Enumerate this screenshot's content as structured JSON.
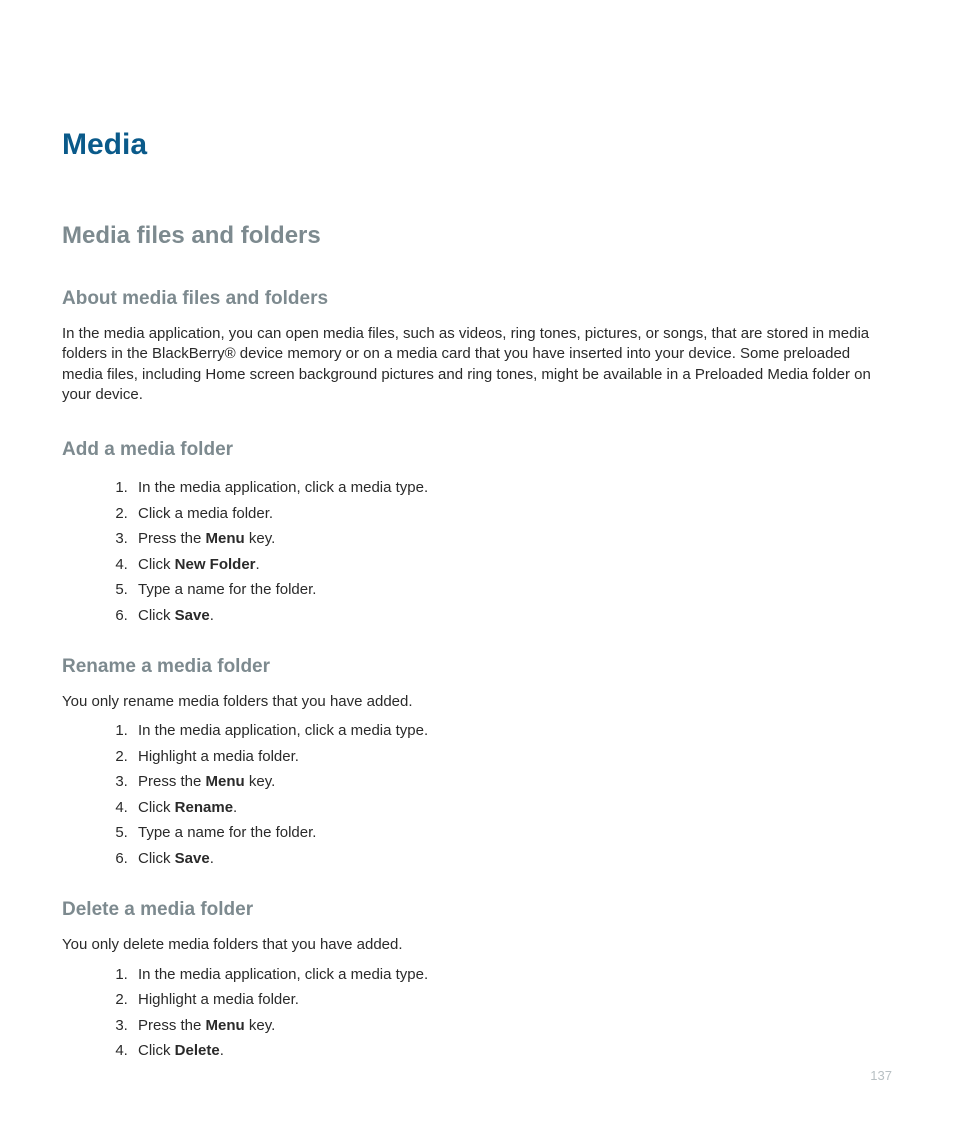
{
  "title": "Media",
  "section": "Media files and folders",
  "about": {
    "heading": "About media files and folders",
    "text": "In the media application, you can open media files, such as videos, ring tones, pictures, or songs, that are stored in media folders in the BlackBerry® device memory or on a media card that you have inserted into your device. Some preloaded media files, including Home screen background pictures and ring tones, might be available in a Preloaded Media folder on your device."
  },
  "add": {
    "heading": "Add a media folder",
    "steps": [
      {
        "pre": "In the media application, click a media type.",
        "bold": "",
        "post": ""
      },
      {
        "pre": "Click a media folder.",
        "bold": "",
        "post": ""
      },
      {
        "pre": "Press the ",
        "bold": "Menu",
        "post": " key."
      },
      {
        "pre": "Click ",
        "bold": "New Folder",
        "post": "."
      },
      {
        "pre": "Type a name for the folder.",
        "bold": "",
        "post": ""
      },
      {
        "pre": "Click ",
        "bold": "Save",
        "post": "."
      }
    ]
  },
  "rename": {
    "heading": "Rename a media folder",
    "note": "You only rename media folders that you have added.",
    "steps": [
      {
        "pre": "In the media application, click a media type.",
        "bold": "",
        "post": ""
      },
      {
        "pre": "Highlight a media folder.",
        "bold": "",
        "post": ""
      },
      {
        "pre": "Press the ",
        "bold": "Menu",
        "post": " key."
      },
      {
        "pre": "Click ",
        "bold": "Rename",
        "post": "."
      },
      {
        "pre": "Type a name for the folder.",
        "bold": "",
        "post": ""
      },
      {
        "pre": "Click ",
        "bold": "Save",
        "post": "."
      }
    ]
  },
  "del": {
    "heading": "Delete a media folder",
    "note": "You only delete media folders that you have added.",
    "steps": [
      {
        "pre": "In the media application, click a media type.",
        "bold": "",
        "post": ""
      },
      {
        "pre": "Highlight a media folder.",
        "bold": "",
        "post": ""
      },
      {
        "pre": "Press the ",
        "bold": "Menu",
        "post": " key."
      },
      {
        "pre": "Click ",
        "bold": "Delete",
        "post": "."
      }
    ]
  },
  "pagenum": "137"
}
